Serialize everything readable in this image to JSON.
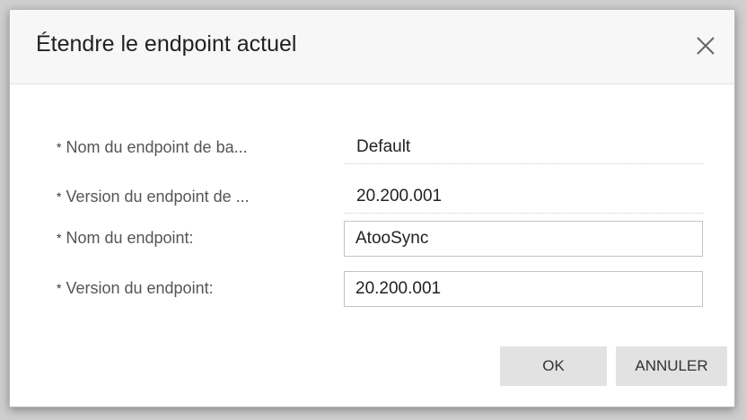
{
  "dialog": {
    "title": "Étendre le endpoint actuel",
    "close_icon": "close-icon"
  },
  "form": {
    "required_marker": "*",
    "fields": [
      {
        "label": "Nom du endpoint de ba...",
        "value": "Default",
        "type": "readonly"
      },
      {
        "label": "Version du endpoint de ...",
        "value": "20.200.001",
        "type": "readonly"
      },
      {
        "label": "Nom du endpoint:",
        "value": "AtooSync",
        "type": "input"
      },
      {
        "label": "Version du endpoint:",
        "value": "20.200.001",
        "type": "input"
      }
    ]
  },
  "buttons": {
    "ok_label": "OK",
    "cancel_label": "ANNULER"
  }
}
